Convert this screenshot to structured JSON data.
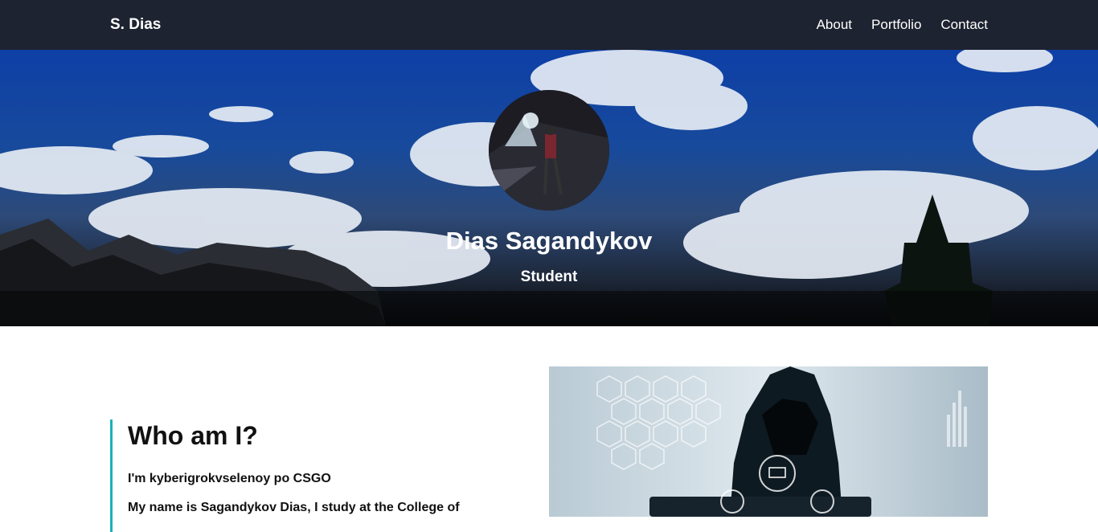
{
  "nav": {
    "brand": "S. Dias",
    "links": [
      "About",
      "Portfolio",
      "Contact"
    ]
  },
  "hero": {
    "name": "Dias Sagandykov",
    "role": "Student"
  },
  "about": {
    "title": "Who am I?",
    "p1": "I'm kyberigrokvselenoy po CSGO",
    "p2": "My name is Sagandykov Dias, I study at the College of"
  },
  "colors": {
    "navbar": "#1d2330",
    "accent": "#1ab1b7"
  }
}
